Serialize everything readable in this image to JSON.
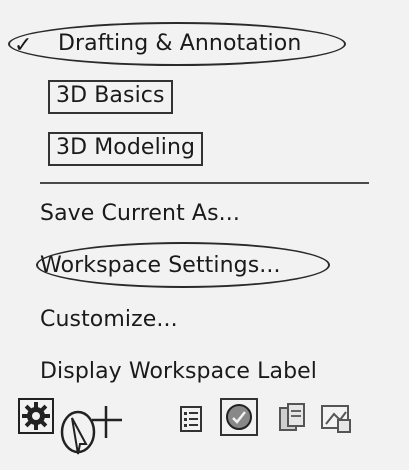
{
  "workspace_menu": {
    "items": [
      {
        "label": "Drafting & Annotation",
        "checked": true
      },
      {
        "label": "3D Basics"
      },
      {
        "label": "3D Modeling"
      }
    ]
  },
  "actions": [
    {
      "label": "Save Current As..."
    },
    {
      "label": "Workspace Settings..."
    },
    {
      "label": "Customize..."
    },
    {
      "label": "Display Workspace Label"
    }
  ],
  "status_bar": {
    "icons": [
      "gear-icon",
      "crosshair-icon",
      "list-icon",
      "isolate-icon",
      "copy-icon",
      "viewport-icon"
    ]
  },
  "colors": {
    "background": "#f2f2f2",
    "text": "#1a1a1a",
    "outline": "#2a2a2a"
  }
}
